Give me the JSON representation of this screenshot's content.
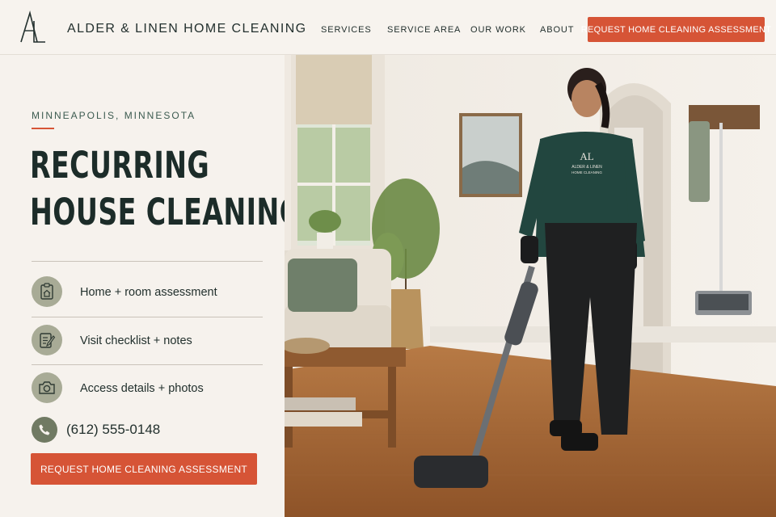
{
  "header": {
    "brand": "ALDER & LINEN HOME CLEANING",
    "logo_letters": "AL",
    "nav": [
      "SERVICES",
      "SERVICE AREA",
      "OUR WORK",
      "ABOUT"
    ],
    "cta_label": "REQUEST HOME CLEANING ASSESSMENT"
  },
  "hero_text": {
    "kicker": "MINNEAPOLIS, MINNESOTA",
    "headline_line1": "RECURRING",
    "headline_line2": "HOUSE CLEANING"
  },
  "features": [
    {
      "icon": "clipboard-house-icon",
      "label": "Home + room assessment"
    },
    {
      "icon": "checklist-pencil-icon",
      "label": "Visit checklist + notes"
    },
    {
      "icon": "camera-icon",
      "label": "Access details + photos"
    }
  ],
  "phone": {
    "icon": "phone-icon",
    "number": "(612) 555-0148"
  },
  "main_cta_label": "REQUEST HOME CLEANING ASSESSMENT",
  "photo": {
    "shirt_logo": "AL",
    "shirt_text_1": "ALDER & LINEN",
    "shirt_text_2": "HOME CLEANING"
  },
  "colors": {
    "accent": "#d65436",
    "background": "#f6f2ed",
    "heading": "#1c2c29",
    "icon_circle": "#a8ab96",
    "phone_circle": "#707a63"
  }
}
